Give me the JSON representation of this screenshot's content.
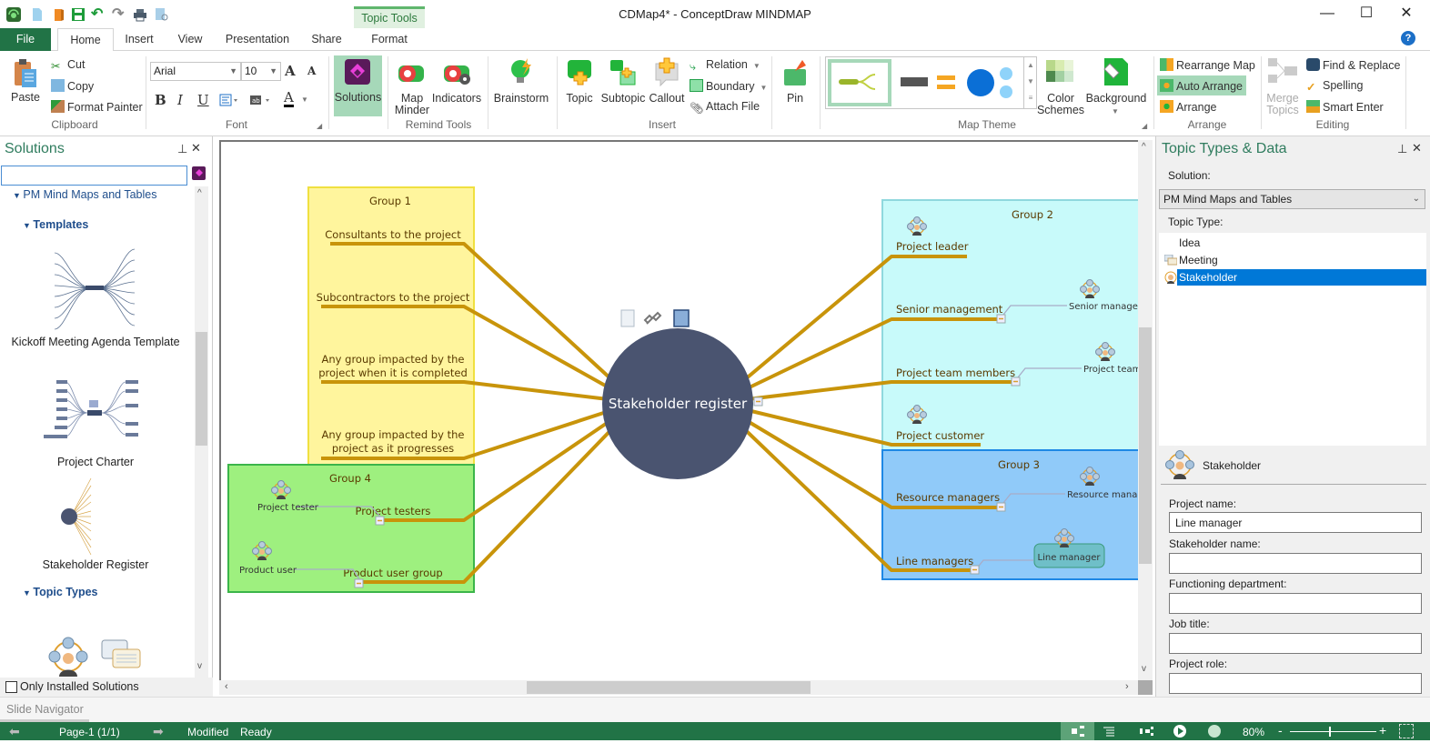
{
  "window": {
    "title": "CDMap4* - ConceptDraw MINDMAP",
    "contextual_tab": "Topic Tools",
    "controls": {
      "minimize": "—",
      "maximize": "☐",
      "close": "✕"
    }
  },
  "quick_access": [
    "app-logo",
    "new-icon",
    "open-icon",
    "save-icon",
    "undo-icon",
    "redo-icon",
    "print-icon",
    "print-preview-icon"
  ],
  "tabs": [
    {
      "label": "File"
    },
    {
      "label": "Home"
    },
    {
      "label": "Insert"
    },
    {
      "label": "View"
    },
    {
      "label": "Presentation"
    },
    {
      "label": "Share"
    },
    {
      "label": "Format"
    }
  ],
  "ribbon": {
    "clipboard": {
      "label": "Clipboard",
      "paste": "Paste",
      "cut": "Cut",
      "copy": "Copy",
      "format_painter": "Format Painter"
    },
    "font": {
      "label": "Font",
      "family": "Arial",
      "size": "10",
      "bold": "B",
      "italic": "I",
      "underline": "U",
      "grow": "A",
      "shrink": "A",
      "color": "A"
    },
    "solutions": {
      "label": "Solutions"
    },
    "remind": {
      "label": "Remind Tools",
      "map_minder": "Map Minder",
      "indicators": "Indicators"
    },
    "brainstorm": {
      "label": "Brainstorm"
    },
    "insert": {
      "label": "Insert",
      "topic": "Topic",
      "subtopic": "Subtopic",
      "callout": "Callout",
      "relation": "Relation",
      "boundary": "Boundary",
      "attach": "Attach File"
    },
    "pin": {
      "label": "Pin"
    },
    "map_theme": {
      "label": "Map Theme",
      "color_schemes": "Color Schemes",
      "background": "Background"
    },
    "arrange": {
      "label": "Arrange",
      "rearrange": "Rearrange Map",
      "auto": "Auto Arrange",
      "arrange": "Arrange"
    },
    "editing": {
      "label": "Editing",
      "merge": "Merge Topics",
      "find": "Find & Replace",
      "spelling": "Spelling",
      "smart_enter": "Smart Enter"
    }
  },
  "solutions_panel": {
    "title": "Solutions",
    "search_value": "",
    "section": "PM Mind Maps and Tables",
    "templates_header": "Templates",
    "templates": [
      {
        "label": "Kickoff Meeting Agenda Template"
      },
      {
        "label": "Project Charter"
      },
      {
        "label": "Stakeholder Register"
      }
    ],
    "topic_types_header": "Topic Types",
    "only_installed": "Only Installed Solutions",
    "only_installed_checked": false
  },
  "map": {
    "central": "Stakeholder register",
    "groups": [
      {
        "name": "Group 1",
        "color": "#fff59d",
        "border": "#f0e040"
      },
      {
        "name": "Group 2",
        "color": "#c8fafa",
        "border": "#8fd8de"
      },
      {
        "name": "Group 3",
        "color": "#90caf9",
        "border": "#1e88e5"
      },
      {
        "name": "Group 4",
        "color": "#9ef07f",
        "border": "#3bb54a"
      }
    ],
    "topics": {
      "consultants": "Consultants to the project",
      "subcontractors": "Subcontractors to the project",
      "impacted_completed_1": "Any group impacted by the",
      "impacted_completed_2": "project when it is completed",
      "impacted_progress_1": "Any group impacted by the",
      "impacted_progress_2": "project as it progresses",
      "project_testers": "Project testers",
      "product_user_group": "Product user group",
      "project_leader": "Project leader",
      "senior_management": "Senior management",
      "project_team_members": "Project team members",
      "project_customer": "Project customer",
      "resource_managers": "Resource managers",
      "line_managers": "Line managers"
    },
    "subtopics": {
      "project_tester": "Project tester",
      "product_user": "Product user",
      "senior_manager": "Senior manager",
      "project_team": "Project team",
      "resource_manager": "Resource manager",
      "line_manager": "Line manager"
    },
    "branch_color": "#c8940a",
    "central_color": "#4a5470"
  },
  "right_panel": {
    "title": "Topic Types & Data",
    "solution_label": "Solution:",
    "solution_value": "PM Mind Maps and Tables",
    "topic_type_label": "Topic Type:",
    "topic_types": [
      {
        "label": "Idea",
        "selected": false
      },
      {
        "label": "Meeting",
        "selected": false
      },
      {
        "label": "Stakeholder",
        "selected": true
      }
    ],
    "type_header": "Stakeholder",
    "fields": [
      {
        "label": "Project name:",
        "value": "Line manager"
      },
      {
        "label": "Stakeholder name:",
        "value": ""
      },
      {
        "label": "Functioning department:",
        "value": ""
      },
      {
        "label": "Job title:",
        "value": ""
      },
      {
        "label": "Project role:",
        "value": ""
      }
    ]
  },
  "slide_navigator": "Slide Navigator",
  "status": {
    "page": "Page-1 (1/1)",
    "modified": "Modified",
    "ready": "Ready",
    "zoom": "80%",
    "zoom_fraction": 0.45
  }
}
